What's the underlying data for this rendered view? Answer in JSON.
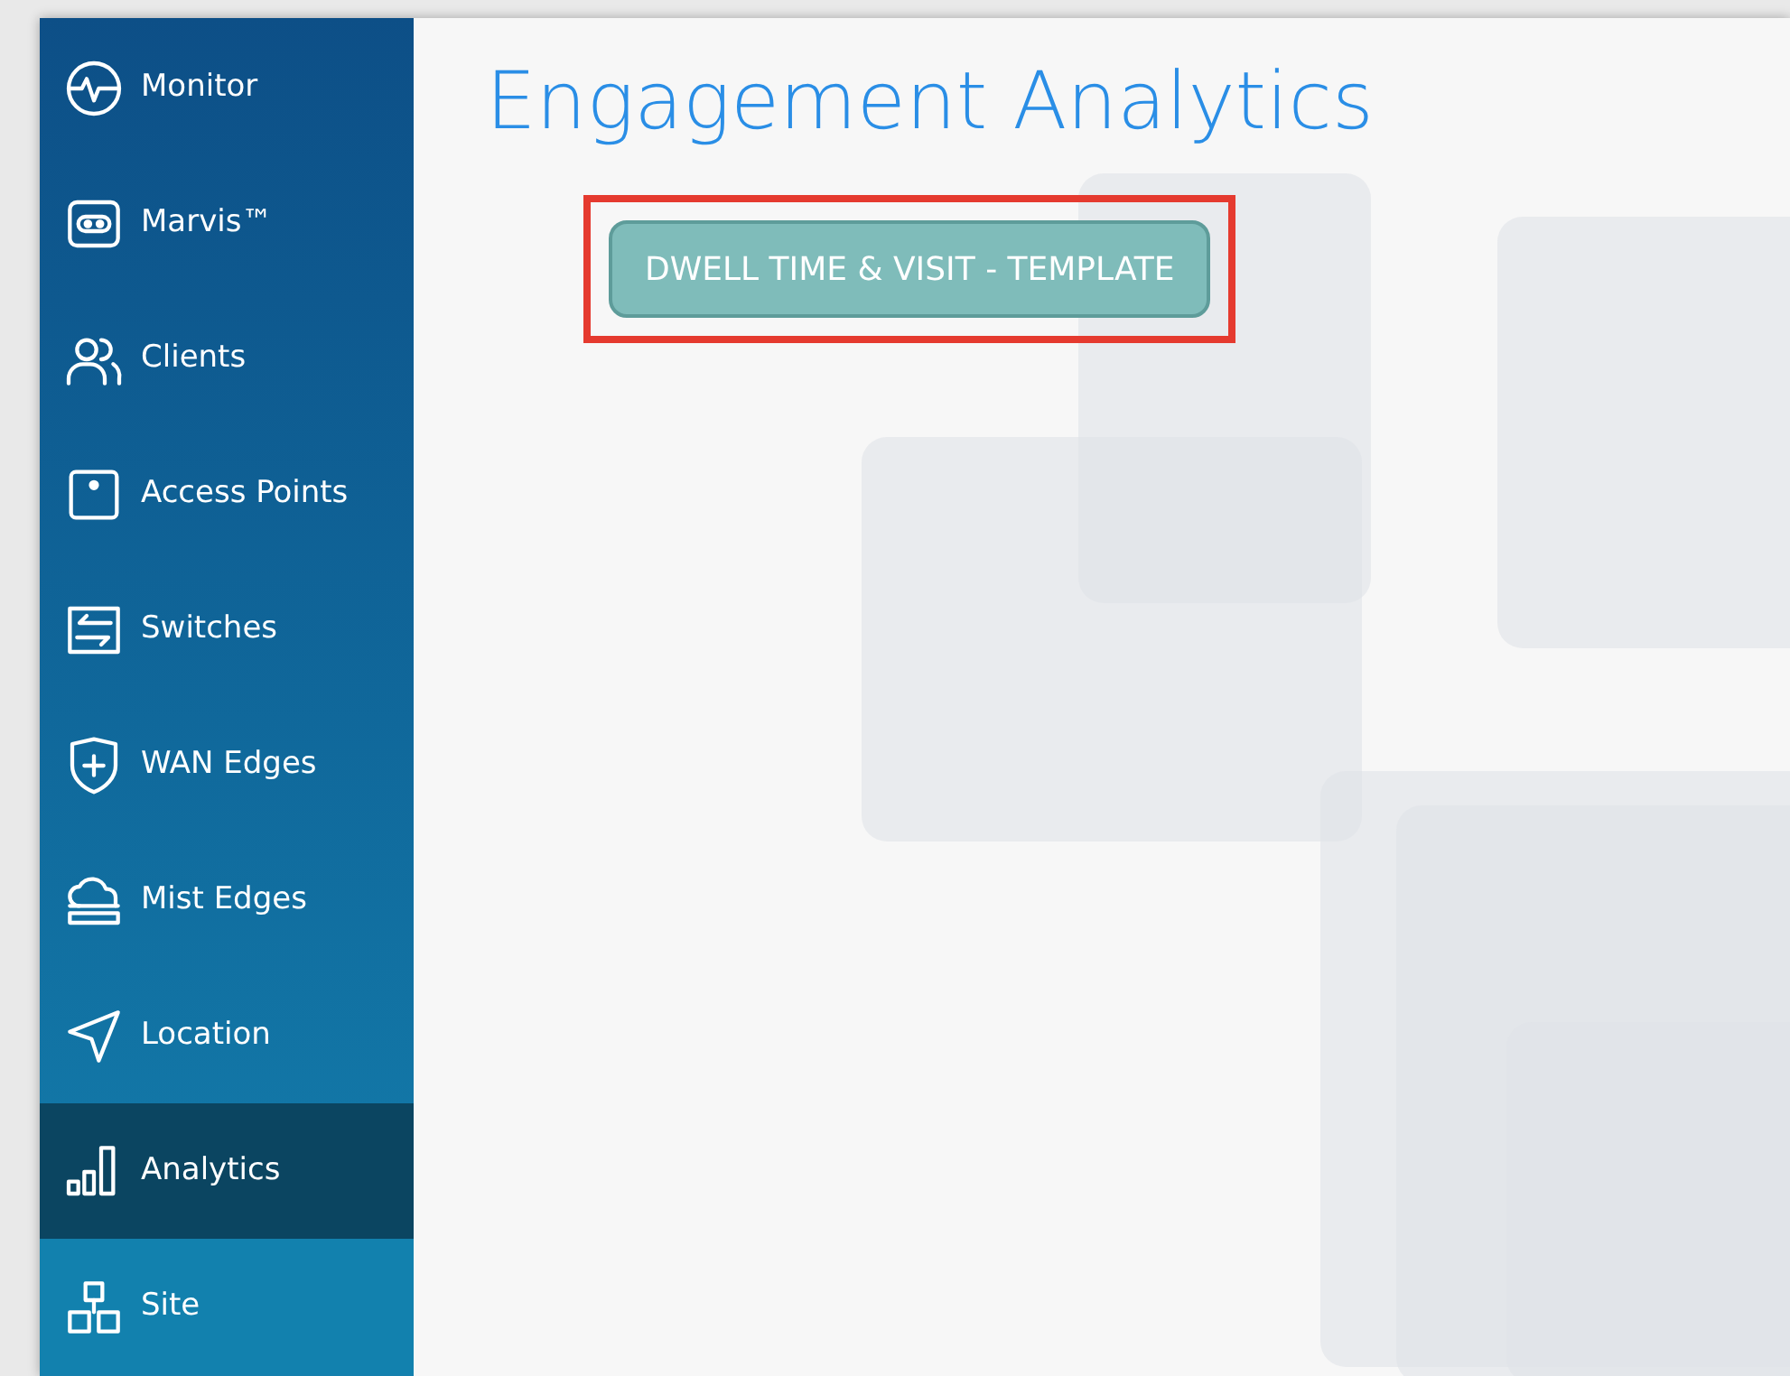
{
  "sidebar": {
    "items": [
      {
        "label": "Monitor",
        "selected": false
      },
      {
        "label": "Marvis™",
        "selected": false
      },
      {
        "label": "Clients",
        "selected": false
      },
      {
        "label": "Access Points",
        "selected": false
      },
      {
        "label": "Switches",
        "selected": false
      },
      {
        "label": "WAN Edges",
        "selected": false
      },
      {
        "label": "Mist Edges",
        "selected": false
      },
      {
        "label": "Location",
        "selected": false
      },
      {
        "label": "Analytics",
        "selected": true
      },
      {
        "label": "Site",
        "selected": false
      }
    ]
  },
  "page": {
    "title": "Engagement Analytics",
    "template_button": {
      "label": "DWELL TIME & VISIT - TEMPLATE",
      "highlighted": true
    }
  }
}
